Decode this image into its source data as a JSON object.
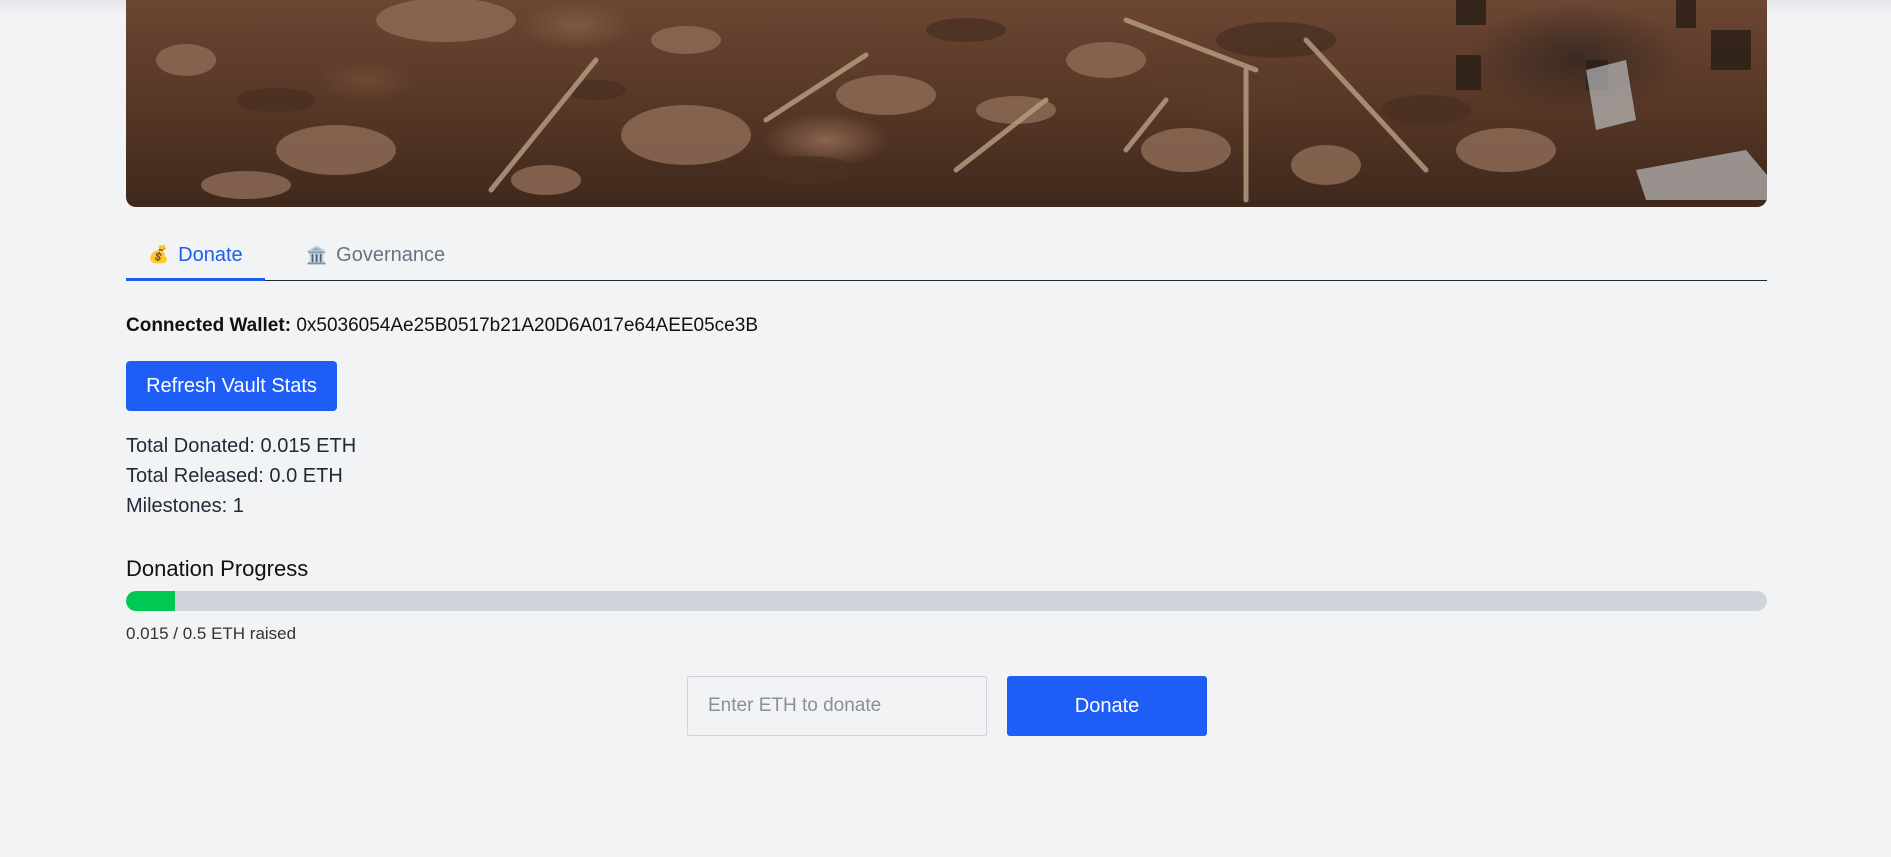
{
  "tabs": [
    {
      "icon": "money-bag-icon",
      "glyph": "💰",
      "label": "Donate",
      "active": true
    },
    {
      "icon": "bank-icon",
      "glyph": "🏛️",
      "label": "Governance",
      "active": false
    }
  ],
  "wallet": {
    "label": "Connected Wallet:",
    "address": "0x5036054Ae25B0517b21A20D6A017e64AEE05ce3B"
  },
  "refresh_label": "Refresh Vault Stats",
  "stats": {
    "total_donated": "Total Donated: 0.015 ETH",
    "total_released": "Total Released: 0.0 ETH",
    "milestones": "Milestones: 1"
  },
  "progress": {
    "title": "Donation Progress",
    "raised": 0.015,
    "goal": 0.5,
    "fraction": 0.03,
    "caption": "0.015 / 0.5 ETH raised"
  },
  "donate_form": {
    "placeholder": "Enter ETH to donate",
    "value": "",
    "button_label": "Donate"
  },
  "colors": {
    "accent": "#1e5ef6",
    "progress_fill": "#00c853",
    "progress_track": "#d1d5db",
    "background": "#f2f3f5"
  }
}
